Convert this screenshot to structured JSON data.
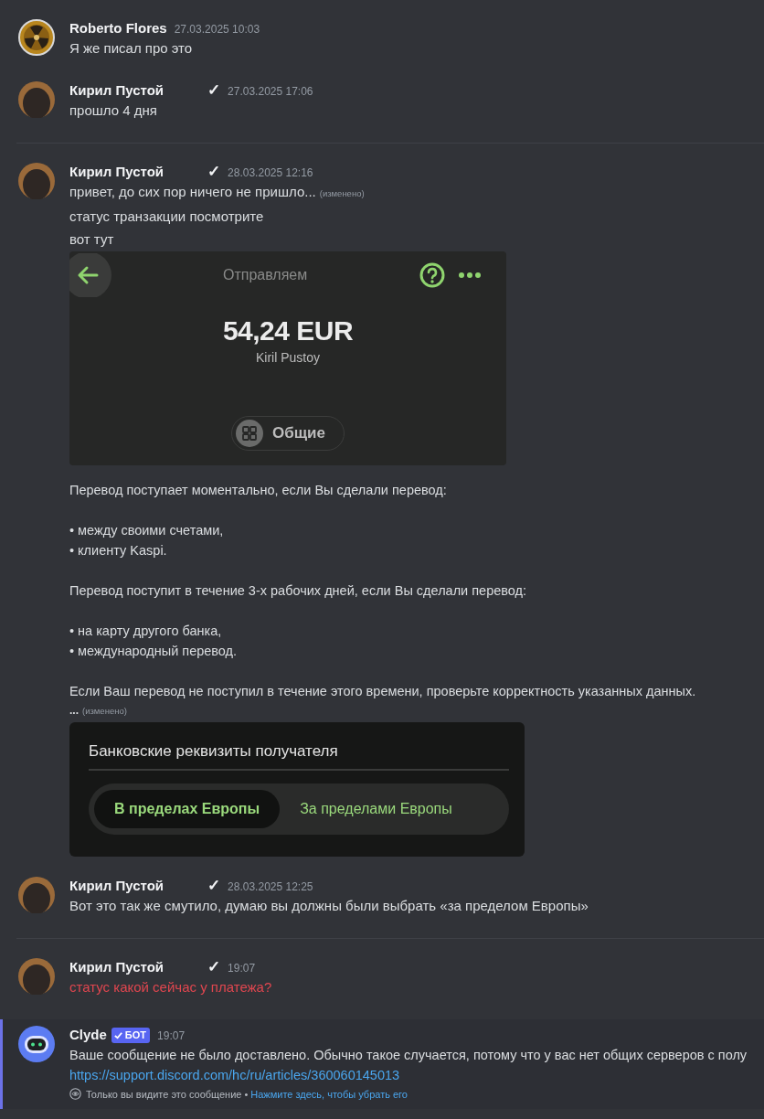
{
  "messages": [
    {
      "author": "Roberto Flores",
      "kind": "emblem",
      "divider_before": false,
      "time": "27.03.2025 10:03",
      "blocks": [
        {
          "kind": "text",
          "text": "Я же писал про это",
          "failed": false
        }
      ]
    },
    {
      "author": "Кирил Пустой",
      "kind": "photo",
      "check": "✓",
      "divider_before": false,
      "time": "27.03.2025 17:06",
      "blocks": [
        {
          "kind": "text",
          "text": "прошло 4 дня",
          "failed": false
        }
      ]
    },
    {
      "author": "Кирил Пустой",
      "kind": "photo",
      "check": "✓",
      "divider_before": true,
      "time": "28.03.2025 12:16",
      "blocks": [
        {
          "kind": "text",
          "text": "привет, до сих пор ничего не пришло...",
          "edited": "(изменено)",
          "failed": false
        },
        {
          "kind": "text",
          "text": "статус транзакции посмотрите",
          "failed": false
        },
        {
          "kind": "text",
          "text": "вот тут",
          "failed": false
        },
        {
          "kind": "transfer_screenshot",
          "title": "Отправляем",
          "amount": "54,24 EUR",
          "recipient": "Kiril Pustoy",
          "category": "Общие"
        },
        {
          "kind": "paragraph",
          "text": "Перевод поступает моментально, если Вы сделали перевод:\n\n• между своими счетами,\n• клиенту Kaspi.\n\nПеревод поступит в течение 3-х рабочих дней, если Вы сделали перевод:\n\n• на карту другого банка,\n• международный перевод.\n\nЕсли Ваш перевод не поступил в течение этого времени, проверьте корректность указанных данных."
        },
        {
          "kind": "small",
          "text": "...",
          "edited": "(изменено)"
        },
        {
          "kind": "bank_screenshot",
          "title": "Банковские реквизиты получателя",
          "tabs": [
            {
              "label": "В пределах Европы",
              "selected": true
            },
            {
              "label": "За пределами Европы",
              "selected": false
            }
          ]
        }
      ]
    },
    {
      "author": "Кирил Пустой",
      "kind": "photo",
      "check": "✓",
      "divider_before": false,
      "time": "28.03.2025 12:25",
      "blocks": [
        {
          "kind": "text",
          "text": "Вот это так же смутило, думаю вы должны были выбрать «за пределом Европы»",
          "failed": false
        }
      ]
    },
    {
      "author": "Кирил Пустой",
      "kind": "photo",
      "check": "✓",
      "divider_before": true,
      "time": "19:07",
      "blocks": [
        {
          "kind": "text",
          "text": "статус какой сейчас у платежа?",
          "failed": true
        }
      ]
    }
  ],
  "system_message": {
    "author": "Clyde",
    "badge": "БОТ",
    "time": "19:07",
    "text": "Ваше сообщение не было доставлено. Обычно такое случается, потому что у вас нет общих серверов с полу",
    "link": "https://support.discord.com/hc/ru/articles/360060145013",
    "notice": "Только вы видите это сообщение",
    "separator": "•",
    "dismiss": "Нажмите здесь, чтобы убрать его"
  }
}
